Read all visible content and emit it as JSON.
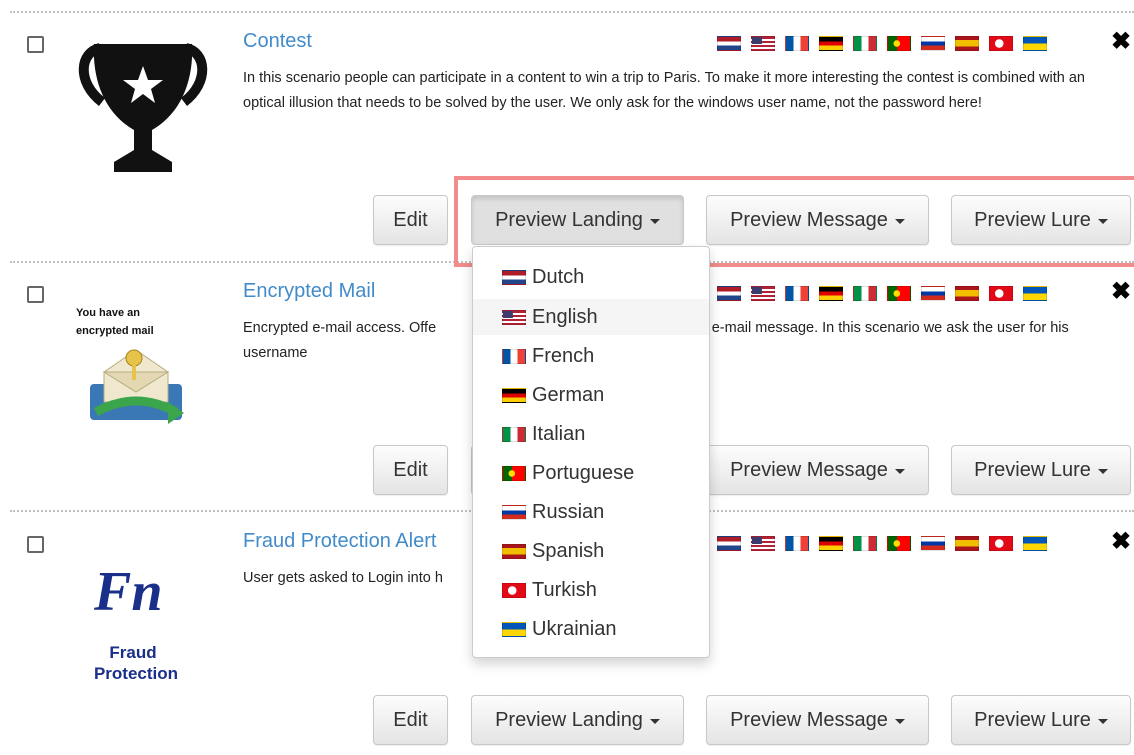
{
  "scenarios": [
    {
      "title": "Contest",
      "description": "In this scenario people can participate in a content to win a trip to Paris. To make it more interesting the contest is combined with an optical illusion that needs to be solved by the user. We only ask for the windows user name, not the password here!",
      "thumbnail": "trophy-star"
    },
    {
      "title": "Encrypted Mail",
      "description": "Encrypted e-mail access. Offe                                        ess an encrypted e-mail message. In this scenario we ask the user for his username",
      "thumbnail": "encrypted-mail",
      "thumbnail_text": "You have an encrypted mail"
    },
    {
      "title": "Fraud Protection Alert",
      "description": "User gets asked to Login into h                                          gin activities",
      "thumbnail": "fraud-protection",
      "thumbnail_text": {
        "logo": "Fn",
        "line1": "Fraud",
        "line2": "Protection"
      }
    }
  ],
  "flags": [
    "Dutch",
    "English",
    "French",
    "German",
    "Italian",
    "Portuguese",
    "Russian",
    "Spanish",
    "Turkish",
    "Ukrainian"
  ],
  "buttons": {
    "edit": "Edit",
    "preview_landing": "Preview Landing",
    "preview_message": "Preview Message",
    "preview_lure": "Preview Lure"
  },
  "delete_icon": "✖",
  "dropdown": {
    "open_for": "Contest / Preview Landing",
    "hovered": "English",
    "items": [
      "Dutch",
      "English",
      "French",
      "German",
      "Italian",
      "Portuguese",
      "Russian",
      "Spanish",
      "Turkish",
      "Ukrainian"
    ]
  },
  "colors": {
    "link": "#428bca",
    "highlight": "#f28b8b"
  }
}
